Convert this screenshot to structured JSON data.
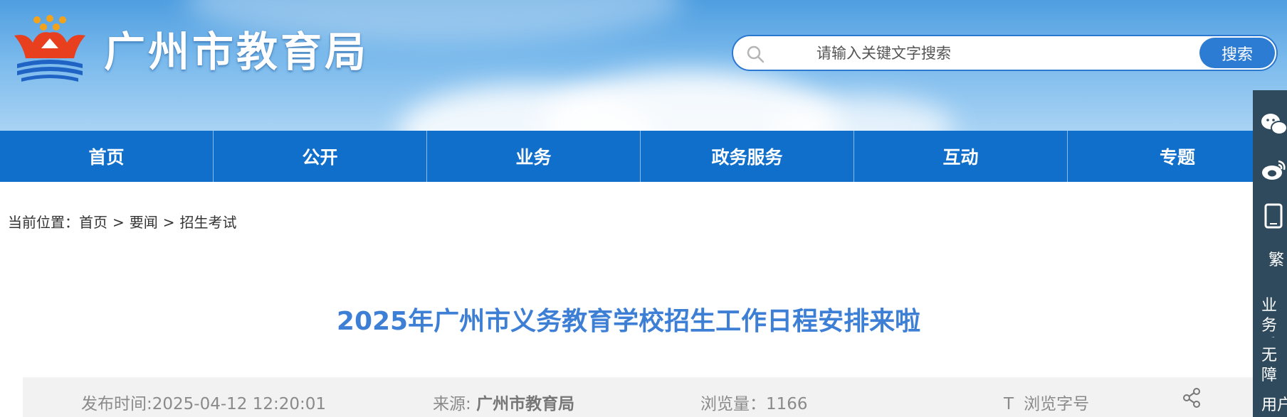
{
  "header": {
    "site_title": "广州市教育局",
    "logo": "guangzhou-education-bureau-emblem",
    "search": {
      "placeholder": "请输入关键文字搜索",
      "value": "",
      "button_label": "搜索",
      "icon": "search-icon"
    }
  },
  "nav": {
    "items": [
      {
        "label": "首页"
      },
      {
        "label": "公开"
      },
      {
        "label": "业务"
      },
      {
        "label": "政务服务"
      },
      {
        "label": "互动"
      },
      {
        "label": "专题"
      }
    ]
  },
  "breadcrumb": {
    "prefix": "当前位置：",
    "items": [
      "首页",
      "要闻",
      "招生考试"
    ],
    "separator": ">"
  },
  "article": {
    "title": "2025年广州市义务教育学校招生工作日程安排来啦",
    "meta": {
      "publish_time": "发布时间:2025-04-12 12:20:01",
      "source_label": "来源:",
      "source_value": "广州市教育局",
      "views": "浏览量：1166",
      "font_size_icon_text": "T",
      "font_size_label": "浏览字号",
      "share_icon": "share-icon"
    }
  },
  "side_rail": {
    "items": [
      {
        "icon": "wechat-icon"
      },
      {
        "icon": "weibo-icon"
      },
      {
        "icon": "mobile-icon"
      },
      {
        "label": "繁"
      },
      {
        "label": "业务系统"
      },
      {
        "label": "无障碍版"
      },
      {
        "label": "用户"
      }
    ]
  },
  "colors": {
    "nav_bg": "#0f6fcb",
    "title": "#3e7fd6",
    "search_button": "#2d7cd3",
    "side_rail_bg": "#2e4a5c",
    "meta_bg": "#f2f2f2"
  }
}
